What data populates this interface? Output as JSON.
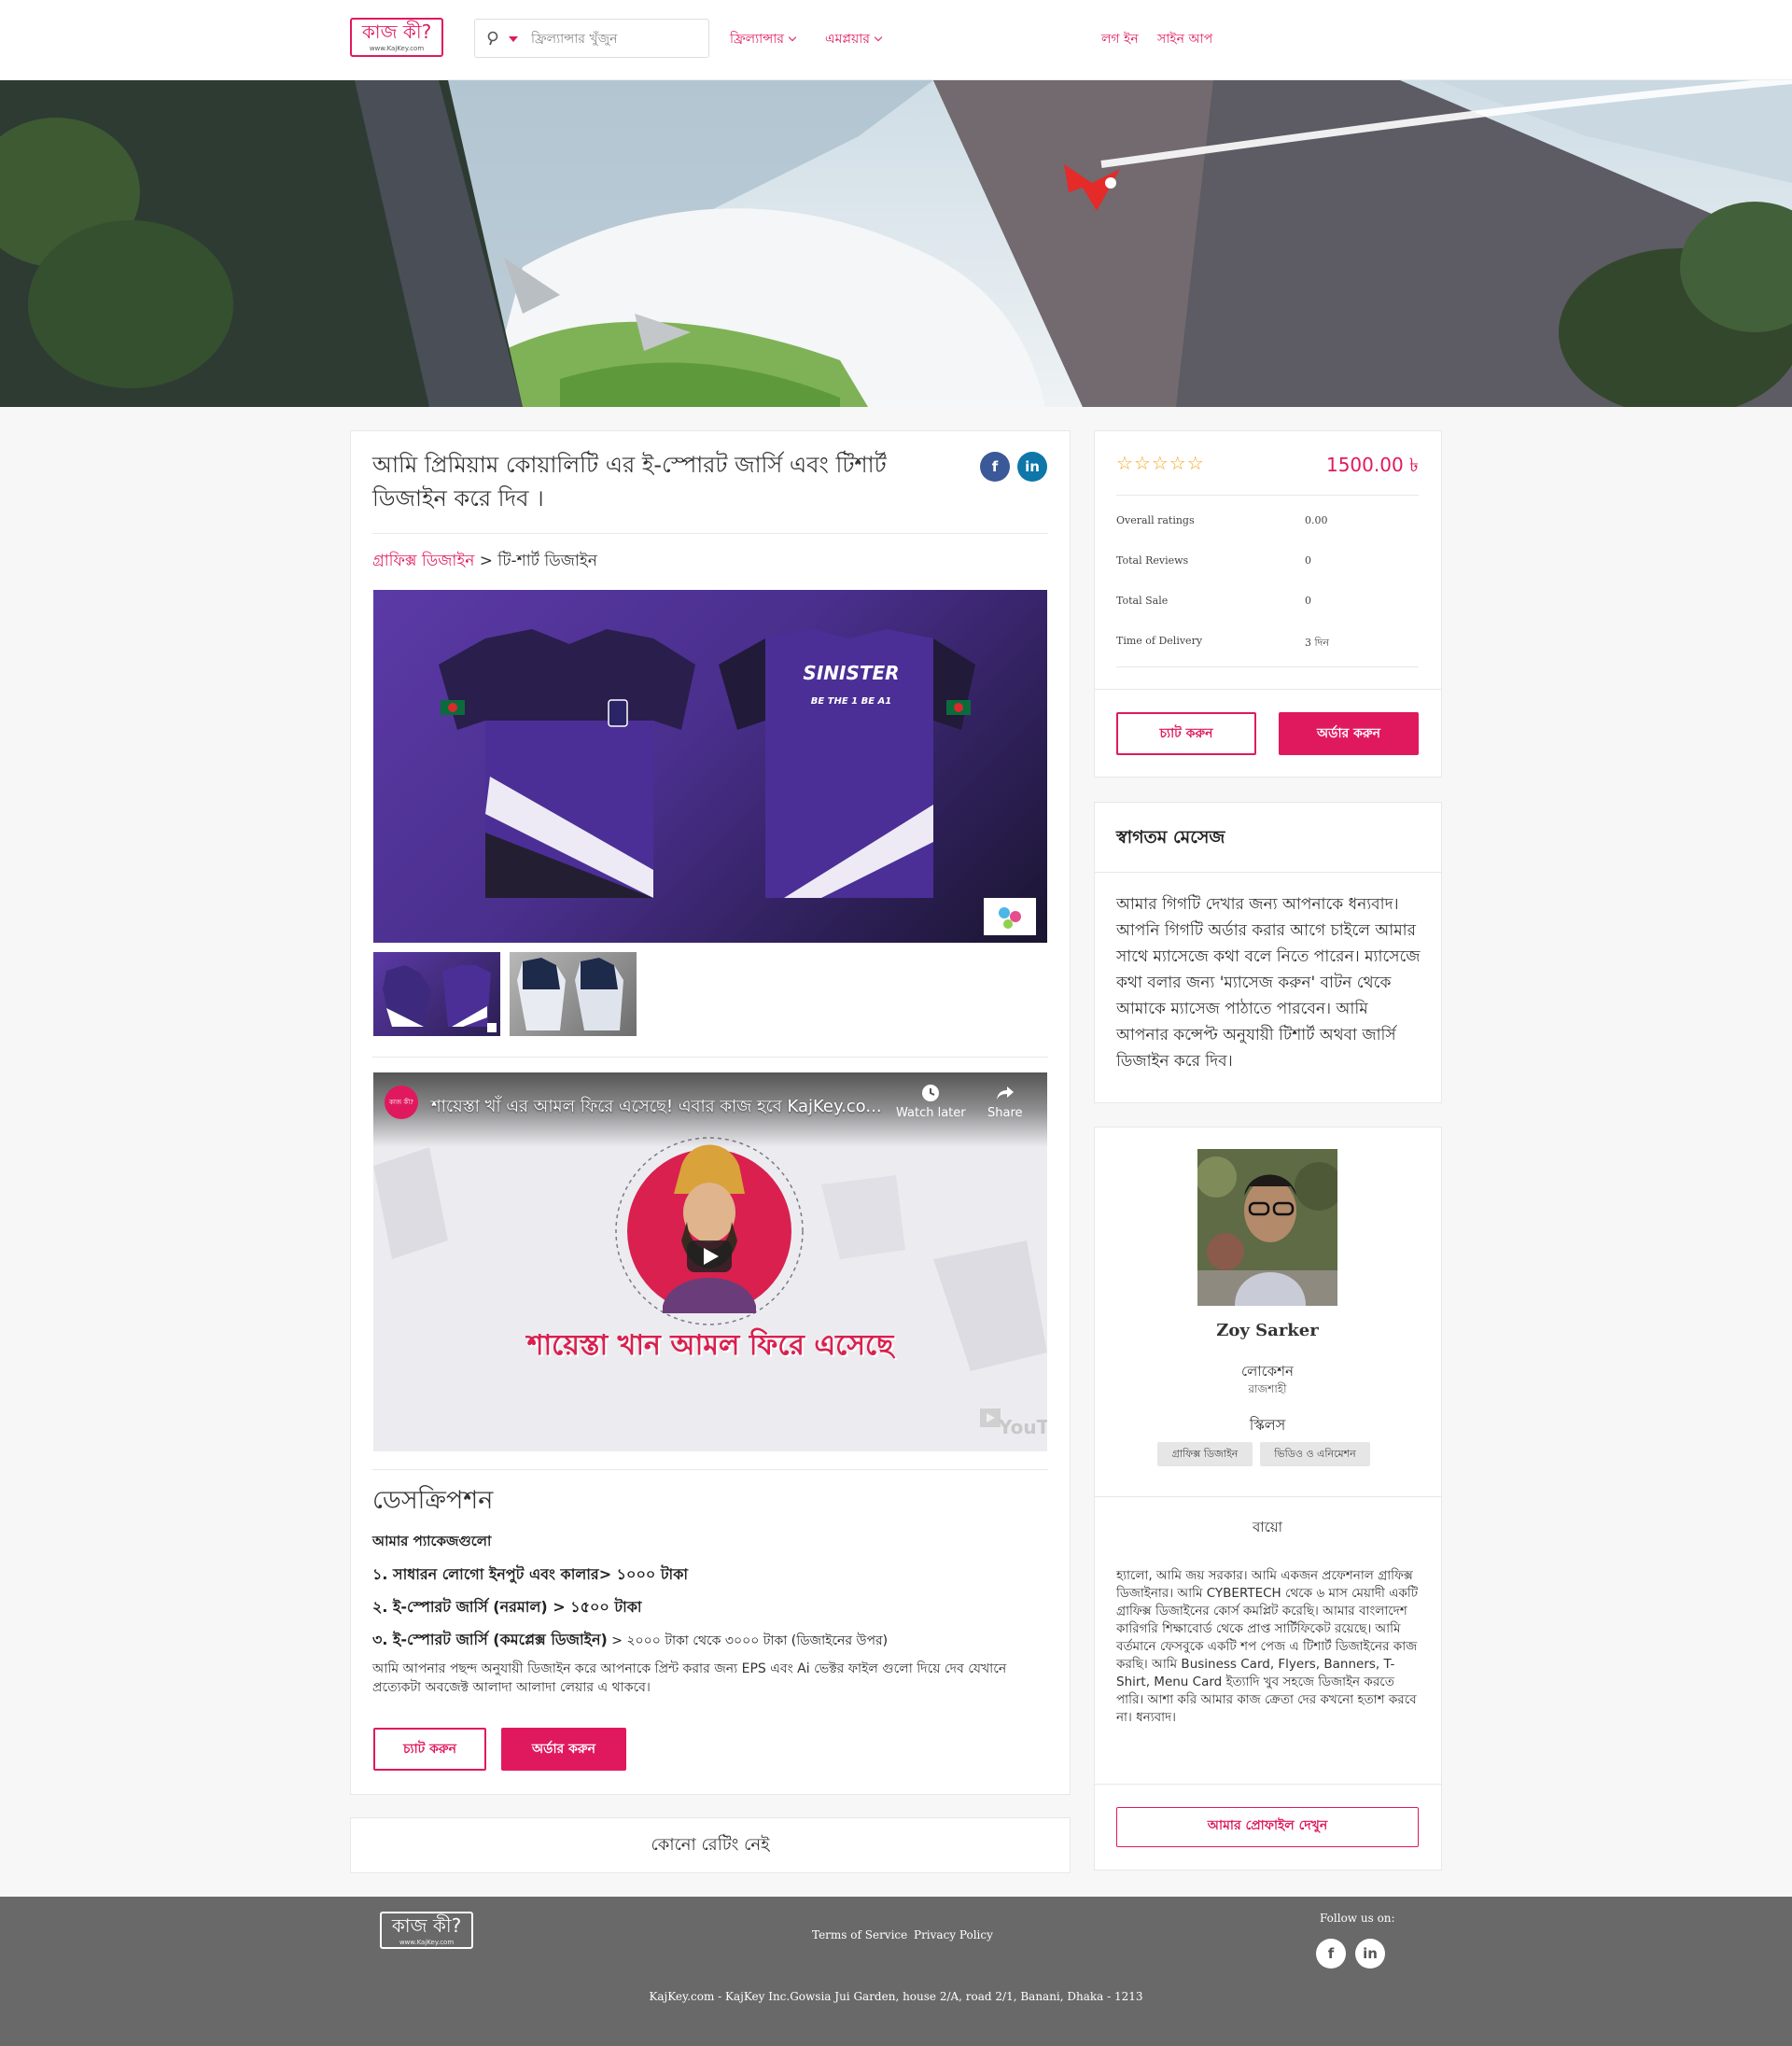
{
  "brand": {
    "logo_text": "কাজ কী?",
    "logo_sub": "www.KajKey.com",
    "color": "#e0195f"
  },
  "nav": {
    "search_placeholder": "ফ্রিল্যান্সার খুঁজুন",
    "freelancer": "ফ্রিল্যান্সার",
    "employer": "এমপ্লয়ার",
    "login": "লগ ইন",
    "signup": "সাইন আপ"
  },
  "gig": {
    "title": "আমি প্রিমিয়াম কোয়ালিটি এর ই-স্পোরট জার্সি এবং টিশার্ট ডিজাইন করে দিব ।",
    "breadcrumb_category": "গ্রাফিক্স ডিজাইন",
    "breadcrumb_sep": " > ",
    "breadcrumb_sub": "টি-শার্ট ডিজাইন",
    "image": {
      "jersey_brand": "SINISTER",
      "jersey_tagline": "BE THE 1 BE A1"
    }
  },
  "video": {
    "title": "শায়েস্তা খাঁ এর আমল ফিরে এসেছে! এবার কাজ হবে KajKey.co...",
    "channel_badge": "কাজ কী?",
    "watch_later": "Watch later",
    "share": "Share",
    "caption": "শায়েস্তা খান আমল ফিরে এসেছে",
    "brand": "YouTube"
  },
  "description": {
    "heading": "ডেসক্রিপশন",
    "packages_heading": "আমার প্যাকেজগুলো",
    "line1": "১. সাধারন লোগো ইনপুট এবং কালার> ১০০০ টাকা",
    "line2": "২. ই-স্পোরট জার্সি (নরমাল) > ১৫০০ টাকা",
    "line3_bold": "৩. ই-স্পোরট জার্সি (কমপ্লেক্স ডিজাইন)",
    "line3_rest": " > ২০০০ টাকা থেকে ৩০০০ টাকা (ডিজাইনের উপর)",
    "paragraph": "আমি আপনার পছন্দ অনুযায়ী ডিজাইন করে আপনাকে প্রিন্ট করার জন্য EPS এবং Ai ভেক্টর ফাইল গুলো দিয়ে দেব যেখানে প্রত্যেকটা অবজেক্ট আলাদা আলাদা লেয়ার এ থাকবে।"
  },
  "actions": {
    "chat": "চ্যাট করুন",
    "order": "অর্ডার করুন"
  },
  "reviews": {
    "empty": "কোনো রেটিং নেই"
  },
  "sidebar": {
    "stars": "☆☆☆☆☆",
    "rating_stars": 0,
    "price": "1500.00 ৳",
    "stats": [
      {
        "label": "Overall ratings",
        "value": "0.00"
      },
      {
        "label": "Total Reviews",
        "value": "0"
      },
      {
        "label": "Total Sale",
        "value": "0"
      },
      {
        "label": "Time of Delivery",
        "value": "3 দিন"
      }
    ]
  },
  "welcome": {
    "heading": "স্বাগতম মেসেজ",
    "message": "আমার গিগটি দেখার জন্য আপনাকে ধন্যবাদ। আপনি গিগটি অর্ডার করার আগে চাইলে আমার সাথে ম্যাসেজে কথা বলে নিতে পারেন। ম্যাসেজে কথা বলার জন্য 'ম্যাসেজ করুন' বাটন থেকে আমাকে ম্যাসেজ পাঠাতে পারবেন। আমি আপনার কন্সেপ্ট অনুযায়ী টিশার্ট অথবা জার্সি ডিজাইন করে দিব।"
  },
  "profile": {
    "name": "Zoy Sarker",
    "location_label": "লোকেশন",
    "location": "রাজশাহী",
    "skills_label": "স্কিলস",
    "skills": [
      "গ্রাফিক্স ডিজাইন",
      "ভিডিও ও এনিমেশন"
    ],
    "bio_label": "বায়ো",
    "bio": "হ্যালো, আমি জয় সরকার। আমি একজন প্রফেশনাল গ্রাফিক্স ডিজাইনার। আমি CYBERTECH থেকে ৬ মাস মেয়াদী একটি গ্রাফিক্স ডিজাইনের কোর্স কমপ্লিট করেছি। আমার বাংলাদেশ কারিগরি শিক্ষাবোর্ড থেকে প্রাপ্ত সার্টিফিকেট রয়েছে। আমি বর্তমানে ফেসবুকে একটি শপ পেজ এ টিশার্ট ডিজাইনের কাজ করছি। আমি Business Card, Flyers, Banners, T-Shirt, Menu Card ইত্যাদি খুব সহজে ডিজাইন করতে পারি। আশা করি আমার কাজ ক্রেতা দের কখনো হতাশ করবে না। ধন্যবাদ।",
    "view_profile": "আমার প্রোফাইল দেখুন"
  },
  "footer": {
    "terms": "Terms of Service",
    "privacy": "Privacy Policy",
    "follow": "Follow us on:",
    "copyright": "KajKey.com - KajKey Inc.Gowsia Jui Garden, house 2/A, road 2/1, Banani, Dhaka - 1213"
  }
}
